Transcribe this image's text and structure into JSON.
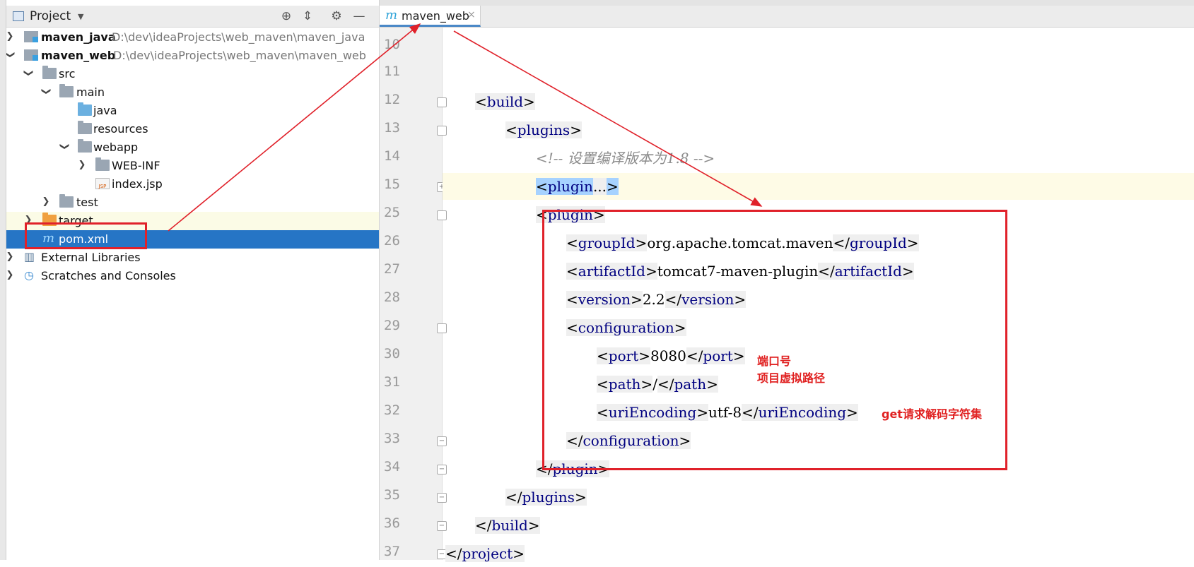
{
  "project_panel": {
    "title": "Project",
    "buttons": [
      "locate-icon",
      "collapse-icon",
      "gear-icon",
      "minimize-icon"
    ],
    "tree": [
      {
        "label": "maven_java",
        "path": "D:\\dev\\ideaProjects\\web_maven\\maven_java",
        "bold": true,
        "icon": "module-icon",
        "expanded": false
      },
      {
        "label": "maven_web",
        "path": "D:\\dev\\ideaProjects\\web_maven\\maven_web",
        "bold": true,
        "icon": "module-icon",
        "expanded": true
      },
      {
        "label": "src",
        "icon": "folder-icon",
        "expanded": true
      },
      {
        "label": "main",
        "icon": "folder-icon",
        "expanded": true
      },
      {
        "label": "java",
        "icon": "source-folder-icon"
      },
      {
        "label": "resources",
        "icon": "resources-folder-icon"
      },
      {
        "label": "webapp",
        "icon": "web-folder-icon",
        "expanded": true
      },
      {
        "label": "WEB-INF",
        "icon": "folder-icon",
        "expanded": false
      },
      {
        "label": "index.jsp",
        "icon": "jsp-file-icon"
      },
      {
        "label": "test",
        "icon": "folder-icon",
        "expanded": false
      },
      {
        "label": "target",
        "icon": "excluded-folder-icon",
        "expanded": false
      },
      {
        "label": "pom.xml",
        "icon": "maven-file-icon",
        "selected": true
      },
      {
        "label": "External Libraries",
        "icon": "libraries-icon",
        "expanded": false
      },
      {
        "label": "Scratches and Consoles",
        "icon": "scratches-icon",
        "expanded": false
      }
    ]
  },
  "editor": {
    "tab": {
      "label": "maven_web",
      "icon": "maven-m-icon",
      "close": "×"
    },
    "line_numbers": [
      "10",
      "11",
      "12",
      "13",
      "14",
      "15",
      "25",
      "26",
      "27",
      "28",
      "29",
      "30",
      "31",
      "32",
      "33",
      "34",
      "35",
      "36",
      "37"
    ],
    "code": {
      "build_tag": "build",
      "plugins_tag": "plugins",
      "comment": "<!-- 设置编译版本为1.8 -->",
      "plugin_tag": "plugin",
      "folded_ellipsis": "...",
      "groupId_tag": "groupId",
      "groupId_value": "org.apache.tomcat.maven",
      "artifactId_tag": "artifactId",
      "artifactId_value": "tomcat7-maven-plugin",
      "version_tag": "version",
      "version_value": "2.2",
      "configuration_tag": "configuration",
      "port_tag": "port",
      "port_value": "8080",
      "path_tag": "path",
      "path_value": "/",
      "uriEncoding_tag": "uriEncoding",
      "uriEncoding_value": "utf-8",
      "project_tag": "project"
    }
  },
  "annotations": {
    "port_note": "端口号",
    "path_note": "项目虚拟路径",
    "encoding_note": "get请求解码字符集"
  },
  "colors": {
    "selection": "#2675c5",
    "annotation_red": "#e0212a",
    "xml_tag": "#000080",
    "comment": "#8c8c8c"
  }
}
